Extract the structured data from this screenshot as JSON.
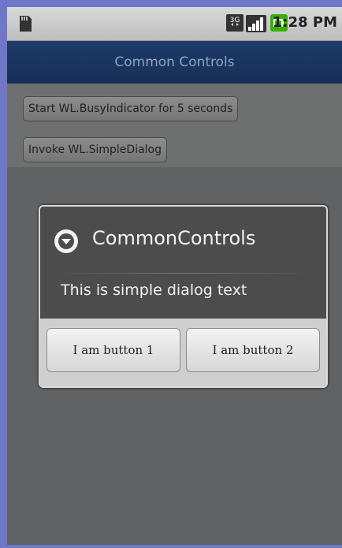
{
  "status_bar": {
    "time": "1:28 PM",
    "icons": [
      "sd-card-icon",
      "3g-icon",
      "signal-icon",
      "battery-charging-icon"
    ],
    "network_label": "3G"
  },
  "app_bar": {
    "title": "Common Controls"
  },
  "content": {
    "buttons": [
      {
        "label": "Start WL.BusyIndicator for 5 seconds"
      },
      {
        "label": "Invoke WL.SimpleDialog"
      }
    ]
  },
  "dialog": {
    "title": "CommonControls",
    "icon": "chevron-circle-icon",
    "message": "This is simple dialog text",
    "buttons": [
      {
        "label": "I am button 1"
      },
      {
        "label": "I am button 2"
      }
    ]
  },
  "colors": {
    "title_bar": "#1e3a6a",
    "accent_green": "#38b000",
    "page_background": "#6f78c8"
  }
}
